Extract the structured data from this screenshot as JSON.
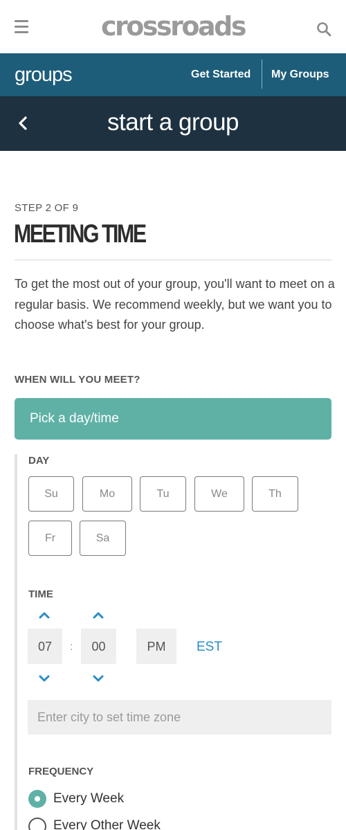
{
  "header": {
    "logo": "crossroads",
    "menu_icon": "hamburger-menu-icon",
    "search_icon": "search-icon"
  },
  "groups_nav": {
    "brand": "groups",
    "get_started": "Get Started",
    "my_groups": "My Groups",
    "background": "#1d5d7a"
  },
  "title_bar": {
    "back_icon": "chevron-left-icon",
    "title": "start a group",
    "background": "#1e3140"
  },
  "main": {
    "step": "STEP 2 OF 9",
    "heading": "MEETING TIME",
    "intro": "To get the most out of your group, you'll want to meet on a regular basis. We recommend weekly, but we want you to choose what's best for your group.",
    "when_label": "WHEN WILL YOU MEET?",
    "pick_button": "Pick a day/time",
    "accent": "#5fb1a6"
  },
  "day": {
    "label": "DAY",
    "options": [
      "Su",
      "Mo",
      "Tu",
      "We",
      "Th",
      "Fr",
      "Sa"
    ]
  },
  "time": {
    "label": "TIME",
    "hour": "07",
    "separator": ":",
    "minute": "00",
    "period": "PM",
    "timezone": "EST",
    "timezone_color": "#2a8cc4",
    "city_placeholder": "Enter city to set time zone"
  },
  "frequency": {
    "label": "FREQUENCY",
    "options": [
      {
        "label": "Every Week",
        "selected": true
      },
      {
        "label": "Every Other Week",
        "selected": false
      }
    ]
  }
}
